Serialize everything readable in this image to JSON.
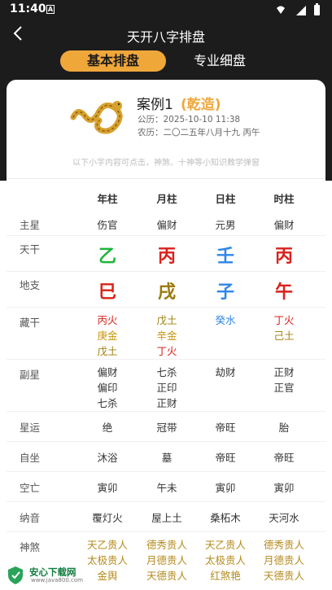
{
  "status_bar": {
    "time": "11:40",
    "notif_letter": "A"
  },
  "nav": {
    "title": "天开八字排盘"
  },
  "tabs": [
    {
      "label": "基本排盘",
      "active": true
    },
    {
      "label": "专业细盘",
      "active": false
    }
  ],
  "header": {
    "case_name": "案例1",
    "gender": "(乾造)",
    "date_gregorian": "公历：2025-10-10 11:38",
    "date_lunar": "农历：二〇二五年八月十九 丙午",
    "hint": "以下小字内容可点击，神煞、十神等小知识教学弹窗"
  },
  "columns": [
    "年柱",
    "月柱",
    "日柱",
    "时柱"
  ],
  "rows": {
    "main_star": {
      "label": "主星",
      "values": [
        "伤官",
        "偏财",
        "元男",
        "偏财"
      ]
    },
    "stem": {
      "label": "天干",
      "values": [
        {
          "text": "乙",
          "color": "#1db53a"
        },
        {
          "text": "丙",
          "color": "#d9221b"
        },
        {
          "text": "壬",
          "color": "#2f86e6"
        },
        {
          "text": "丙",
          "color": "#d9221b"
        }
      ]
    },
    "branch": {
      "label": "地支",
      "values": [
        {
          "text": "巳",
          "color": "#d9221b"
        },
        {
          "text": "戌",
          "color": "#9a7a0c"
        },
        {
          "text": "子",
          "color": "#2f86e6"
        },
        {
          "text": "午",
          "color": "#d9221b"
        }
      ]
    },
    "hidden": {
      "label": "藏干",
      "values": [
        [
          {
            "text": "丙火",
            "color": "#d9221b"
          },
          {
            "text": "庚金",
            "color": "#c9940f"
          },
          {
            "text": "戊土",
            "color": "#a0800f"
          }
        ],
        [
          {
            "text": "戊土",
            "color": "#a0800f"
          },
          {
            "text": "辛金",
            "color": "#c9940f"
          },
          {
            "text": "丁火",
            "color": "#d9221b"
          }
        ],
        [
          {
            "text": "癸水",
            "color": "#2f86e6"
          }
        ],
        [
          {
            "text": "丁火",
            "color": "#d9221b"
          },
          {
            "text": "己土",
            "color": "#a0800f"
          }
        ]
      ]
    },
    "sub_star": {
      "label": "副星",
      "values": [
        [
          "偏财",
          "偏印",
          "七杀"
        ],
        [
          "七杀",
          "正印",
          "正财"
        ],
        [
          "劫财"
        ],
        [
          "正财",
          "正官"
        ]
      ]
    },
    "star_luck": {
      "label": "星运",
      "values": [
        "绝",
        "冠带",
        "帝旺",
        "胎"
      ]
    },
    "self_seat": {
      "label": "自坐",
      "values": [
        "沐浴",
        "墓",
        "帝旺",
        "帝旺"
      ]
    },
    "void": {
      "label": "空亡",
      "values": [
        "寅卯",
        "午未",
        "寅卯",
        "寅卯"
      ]
    },
    "nayin": {
      "label": "纳音",
      "values": [
        "覆灯火",
        "屋上土",
        "桑柘木",
        "天河水"
      ]
    },
    "shensha": {
      "label": "神煞",
      "values": [
        [
          "天乙贵人",
          "太极贵人",
          "金舆"
        ],
        [
          "德秀贵人",
          "月德贵人",
          "天德贵人"
        ],
        [
          "天乙贵人",
          "太极贵人",
          "红煞艳"
        ],
        [
          "德秀贵人",
          "月德贵人",
          "天德贵人"
        ]
      ]
    }
  },
  "watermark": {
    "title": "安心下载网",
    "url": "www.java800.com"
  },
  "colors": {
    "accent": "#f0a73a",
    "dark_bg": "#1c1c1c"
  }
}
